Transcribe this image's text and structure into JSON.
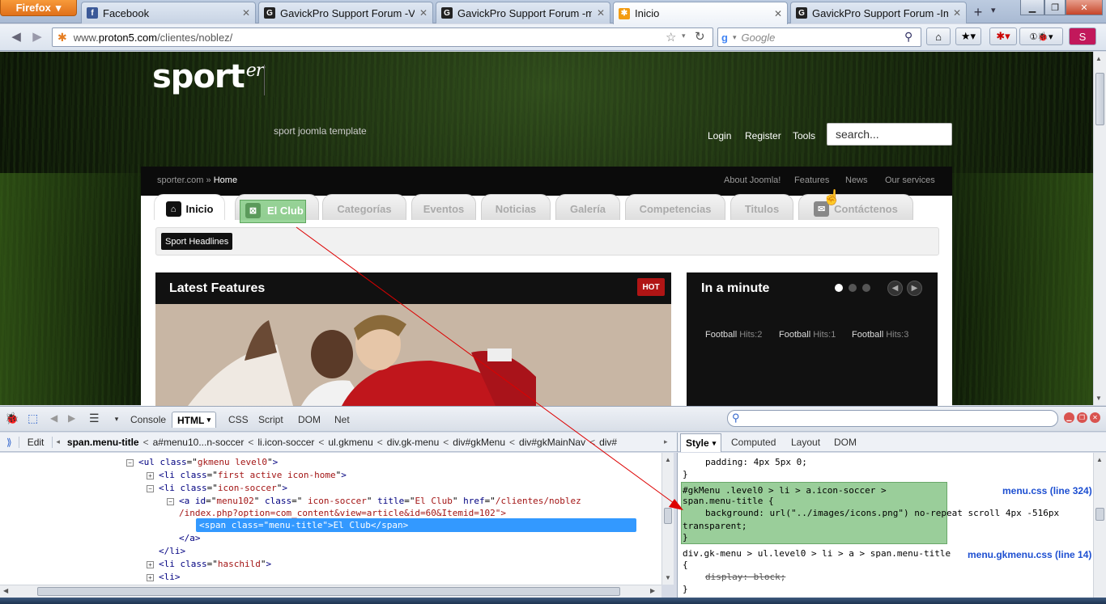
{
  "browser": {
    "menu_button": "Firefox",
    "tabs": [
      {
        "title": "Facebook",
        "favicon": "facebook-icon",
        "color": "#3b5998"
      },
      {
        "title": "GavickPro Support Forum -Vie...",
        "favicon": "gavick-icon",
        "color": "#222222"
      },
      {
        "title": "GavickPro Support Forum -me...",
        "favicon": "gavick-icon",
        "color": "#222222"
      },
      {
        "title": "Inicio",
        "favicon": "joomla-icon",
        "color": "#f39c12"
      },
      {
        "title": "GavickPro Support Forum -Ima...",
        "favicon": "gavick-icon",
        "color": "#222222"
      }
    ],
    "url_prefix": "www.",
    "url_domain": "proton5.com",
    "url_path": "/clientes/noblez/",
    "search_placeholder": "Google"
  },
  "site": {
    "logo": "sport",
    "logo_sup": "er",
    "tagline": "sport joomla template",
    "top_links": [
      "Login",
      "Register",
      "Tools"
    ],
    "search_value": "search...",
    "breadcrumb_site": "sporter.com",
    "breadcrumb_sep": "»",
    "breadcrumb_current": "Home",
    "sub_links": [
      "About Joomla!",
      "Features",
      "News",
      "Our services"
    ],
    "menu": [
      "Inicio",
      "El Club",
      "Categorías",
      "Eventos",
      "Noticias",
      "Galería",
      "Competencias",
      "Titulos",
      "Contáctenos"
    ],
    "headlines_label": "Sport Headlines",
    "latest_title": "Latest Features",
    "hot_badge": "HOT",
    "minute_title": "In a minute",
    "hits": [
      {
        "cat": "Football",
        "label": "Hits:2"
      },
      {
        "cat": "Football",
        "label": "Hits:1"
      },
      {
        "cat": "Football",
        "label": "Hits:3"
      }
    ]
  },
  "firebug": {
    "tabs": [
      "Console",
      "HTML",
      "CSS",
      "Script",
      "DOM",
      "Net"
    ],
    "active_tab": "HTML",
    "edit_label": "Edit",
    "breadcrumbs": [
      "span.menu-title",
      "a#menu10...n-soccer",
      "li.icon-soccer",
      "ul.gkmenu",
      "div.gk-menu",
      "div#gkMenu",
      "div#gkMainNav",
      "div#"
    ],
    "right_tabs": [
      "Style",
      "Computed",
      "Layout",
      "DOM"
    ],
    "html_lines": [
      {
        "open": "<ul",
        "attrs": [
          [
            "class",
            "gkmenu level0"
          ]
        ],
        "close": ">"
      },
      {
        "open": "<li",
        "attrs": [
          [
            "class",
            "first active icon-home"
          ]
        ],
        "close": ">"
      },
      {
        "open": "<li",
        "attrs": [
          [
            "class",
            "icon-soccer"
          ]
        ],
        "close": ">"
      },
      {
        "open": "<a",
        "attrs": [
          [
            "id",
            "menu102"
          ],
          [
            "class",
            " icon-soccer"
          ],
          [
            "title",
            "El Club"
          ],
          [
            "href",
            "/clientes/noblez"
          ]
        ],
        "close": ""
      },
      {
        "text": "/index.php?option=com_content&view=article&id=60&Itemid=102\">"
      },
      {
        "text": "<span class=\"menu-title\">El Club</span>"
      },
      {
        "text": "</a>"
      },
      {
        "text": "</li>"
      },
      {
        "open": "<li",
        "attrs": [
          [
            "class",
            "haschild"
          ]
        ],
        "close": ">"
      },
      {
        "text": "<li>"
      }
    ],
    "css": {
      "line_padding": "padding: 4px 5px 0;",
      "brace_close": "}",
      "rule1_selector_a": "#gkMenu .level0 > li > a.icon-soccer >",
      "rule1_selector_b": "span.menu-title {",
      "rule1_decl": "background: url(\"../images/icons.png\") no-repeat scroll 4px -516px",
      "rule1_decl_b": "transparent;",
      "rule1_source": "menu.css (line 324)",
      "rule2_selector": "div.gk-menu > ul.level0 > li > a > span.menu-title",
      "rule2_open": "{",
      "rule2_decl": "display: block;",
      "rule2_source": "menu.gkmenu.css (line 14)"
    }
  },
  "colors": {
    "selection": "#3399ff",
    "highlight": "#78c878",
    "annotation_arrow": "#dd0000"
  }
}
